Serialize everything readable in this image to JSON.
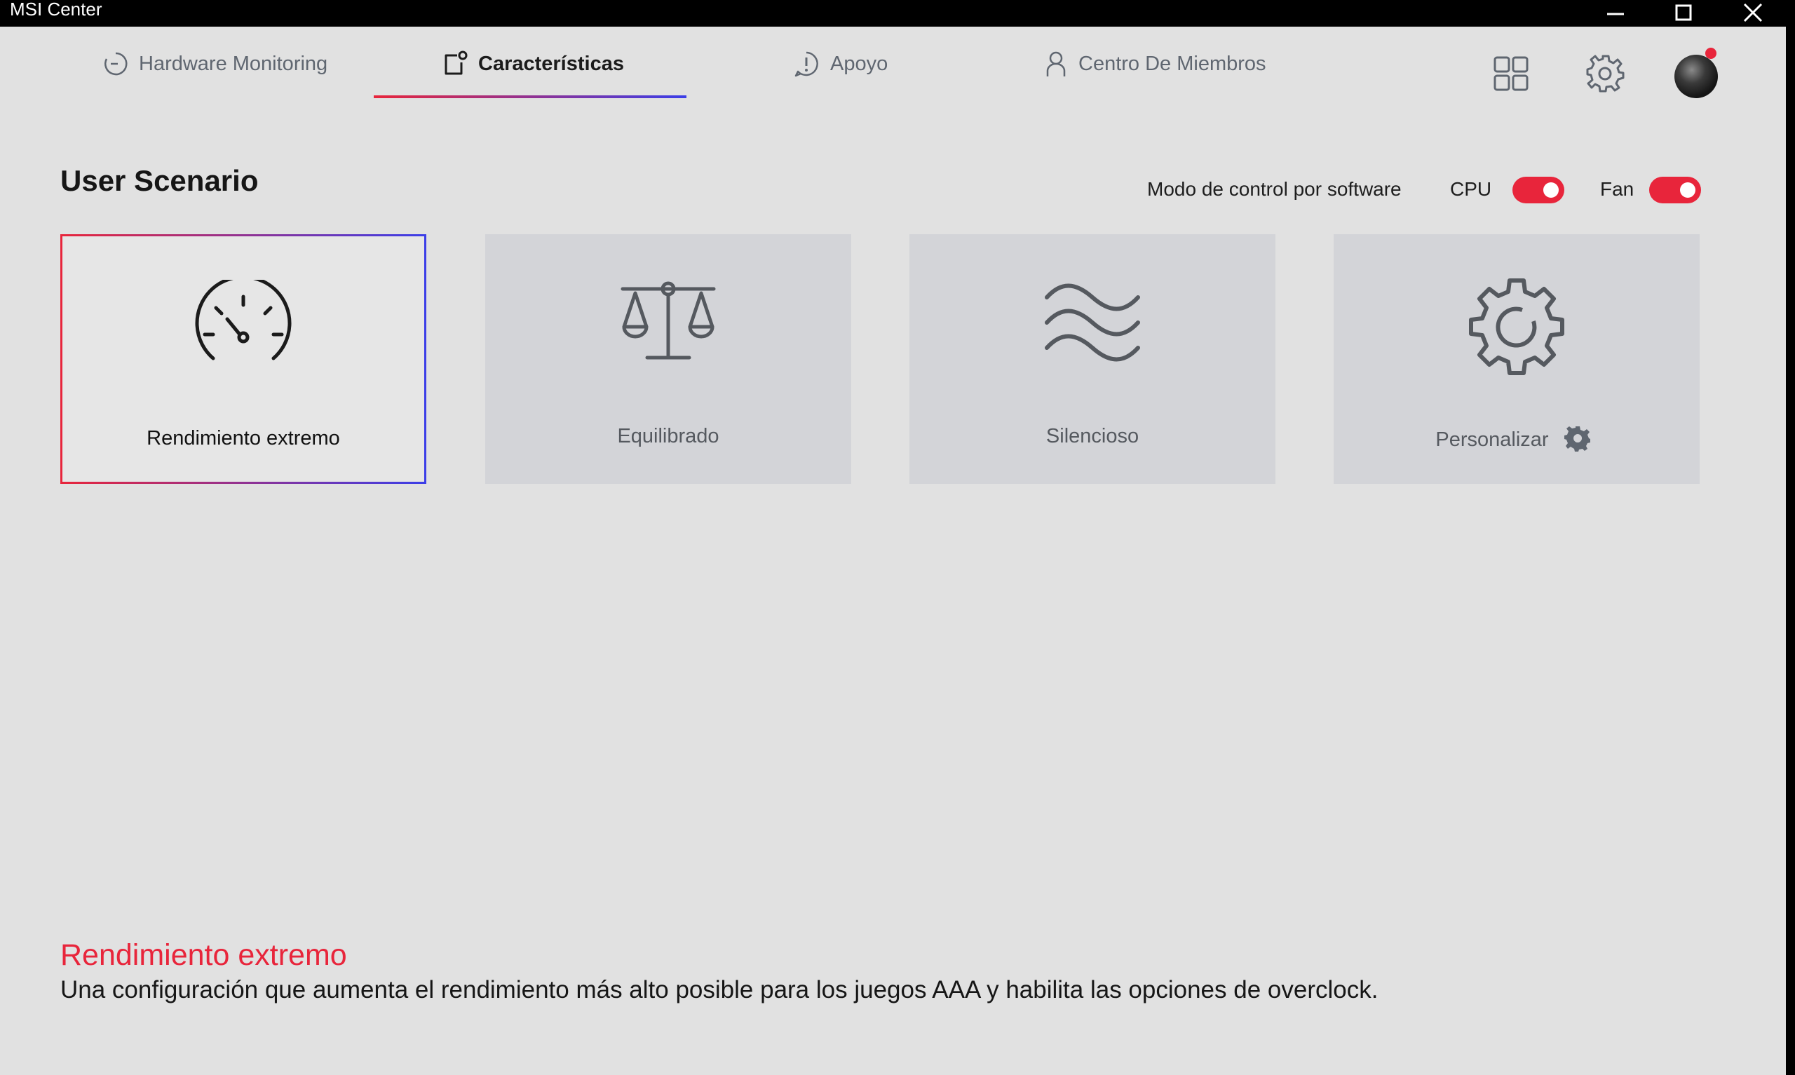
{
  "window": {
    "title": "MSI Center",
    "controls": {
      "minimize": "minimize",
      "maximize": "maximize",
      "close": "close"
    }
  },
  "nav": {
    "tabs": [
      {
        "label": "Hardware Monitoring",
        "icon": "timer-icon",
        "active": false
      },
      {
        "label": "Características",
        "icon": "features-icon",
        "active": true
      },
      {
        "label": "Apoyo",
        "icon": "alert-bubble-icon",
        "active": false
      },
      {
        "label": "Centro De Miembros",
        "icon": "person-icon",
        "active": false
      }
    ],
    "right_icons": [
      "grid-icon",
      "gear-icon",
      "avatar"
    ],
    "notification": true
  },
  "section": {
    "title": "User Scenario",
    "software_control_label": "Modo de control por software",
    "cpu_label": "CPU",
    "cpu_on": true,
    "fan_label": "Fan",
    "fan_on": true
  },
  "scenarios": [
    {
      "label": "Rendimiento extremo",
      "icon": "speedometer-icon",
      "selected": true
    },
    {
      "label": "Equilibrado",
      "icon": "balance-scale-icon",
      "selected": false
    },
    {
      "label": "Silencioso",
      "icon": "waves-icon",
      "selected": false
    },
    {
      "label": "Personalizar",
      "icon": "gear-icon",
      "selected": false,
      "has_settings": true
    }
  ],
  "description": {
    "title": "Rendimiento extremo",
    "text": "Una configuración que aumenta el rendimiento más alto posible para los juegos AAA y habilita las opciones de overclock."
  },
  "colors": {
    "accent_red": "#e8253b",
    "accent_blue": "#3b3ee8",
    "background": "#e1e1e1",
    "card": "#d3d4d8"
  }
}
